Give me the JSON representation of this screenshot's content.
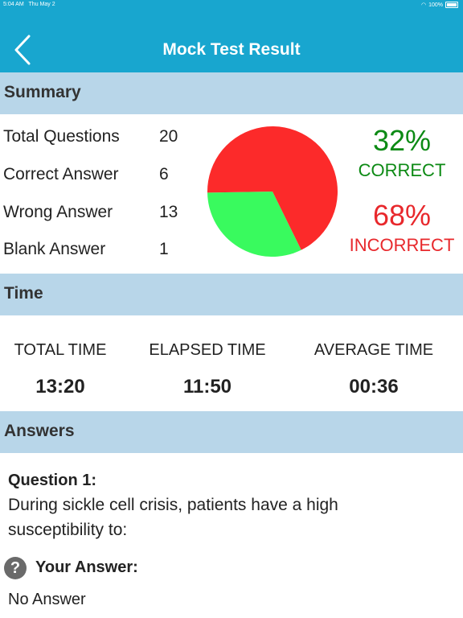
{
  "status": {
    "time": "5:04 AM",
    "date": "Thu May 2",
    "battery": "100%"
  },
  "nav": {
    "title": "Mock Test Result"
  },
  "summary": {
    "heading": "Summary",
    "rows": [
      {
        "label": "Total Questions",
        "value": "20"
      },
      {
        "label": "Correct Answer",
        "value": "6"
      },
      {
        "label": "Wrong Answer",
        "value": "13"
      },
      {
        "label": "Blank Answer",
        "value": "1"
      }
    ],
    "correct_pct": "32%",
    "correct_label": "CORRECT",
    "incorrect_pct": "68%",
    "incorrect_label": "INCORRECT"
  },
  "chart_data": {
    "type": "pie",
    "slices": [
      {
        "label": "CORRECT",
        "value": 32,
        "color": "#39fa5e"
      },
      {
        "label": "INCORRECT",
        "value": 68,
        "color": "#fc2a2a"
      }
    ]
  },
  "time": {
    "heading": "Time",
    "columns": [
      {
        "label": "TOTAL TIME",
        "value": "13:20"
      },
      {
        "label": "ELAPSED TIME",
        "value": "11:50"
      },
      {
        "label": "AVERAGE TIME",
        "value": "00:36"
      }
    ]
  },
  "answers": {
    "heading": "Answers",
    "question_title": "Question 1:",
    "question_text": "During sickle cell crisis, patients have a high susceptibility to:",
    "your_answer_label": "Your Answer:",
    "your_answer_value": "No Answer"
  },
  "colors": {
    "nav": "#18a6cf",
    "section": "#b8d6e9",
    "green": "#0c8a14",
    "red": "#e8282c"
  }
}
